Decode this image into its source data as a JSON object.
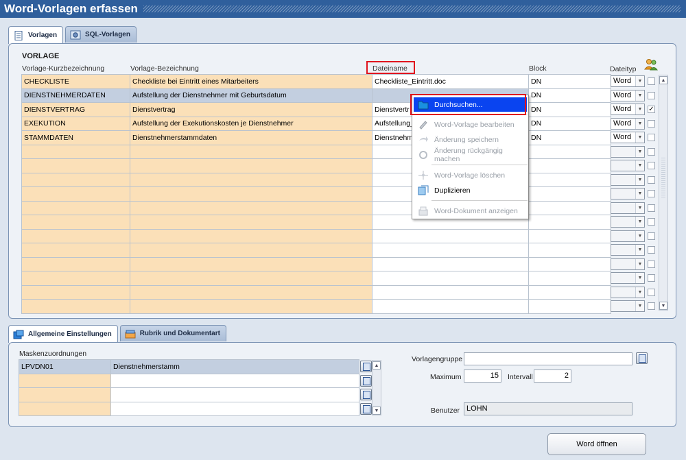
{
  "window": {
    "title": "Word-Vorlagen erfassen"
  },
  "top_tabs": [
    {
      "label": "Vorlagen",
      "icon": "document-lines-icon"
    },
    {
      "label": "SQL-Vorlagen",
      "icon": "sql-gear-icon"
    }
  ],
  "vorlage": {
    "section_label": "VORLAGE",
    "columns": {
      "kurz": "Vorlage-Kurzbezeichnung",
      "bez": "Vorlage-Bezeichnung",
      "datei": "Dateiname",
      "block": "Block",
      "typ": "Dateityp"
    },
    "rows": [
      {
        "kurz": "CHECKLISTE",
        "bez": "Checkliste bei Eintritt eines Mitarbeiters",
        "datei": "Checkliste_Eintritt.doc",
        "block": "DN",
        "typ": "Word",
        "checked": false
      },
      {
        "kurz": "DIENSTNEHMERDATEN",
        "bez": "Aufstellung der Dienstnehmer mit Geburtsdatum",
        "datei": "",
        "block": "DN",
        "typ": "Word",
        "checked": false
      },
      {
        "kurz": "DIENSTVERTRAG",
        "bez": "Dienstvertrag",
        "datei": "Dienstvertr",
        "block": "DN",
        "typ": "Word",
        "checked": true
      },
      {
        "kurz": "EXEKUTION",
        "bez": "Aufstellung der Exekutionskosten je Dienstnehmer",
        "datei": "Aufstellung_",
        "block": "DN",
        "typ": "Word",
        "checked": false
      },
      {
        "kurz": "STAMMDATEN",
        "bez": "Dienstnehmerstammdaten",
        "datei": "Dienstnehm",
        "block": "DN",
        "typ": "Word",
        "checked": false
      }
    ],
    "empty_row_count": 12
  },
  "context_menu": {
    "items": [
      {
        "label": "Durchsuchen...",
        "icon": "folder-icon",
        "enabled": true,
        "highlighted": true
      },
      {
        "label": "Word-Vorlage bearbeiten",
        "icon": "pencil-icon",
        "enabled": false
      },
      {
        "label": "Änderung speichern",
        "icon": "arrow-right-icon",
        "enabled": false
      },
      {
        "label": "Änderung rückgängig machen",
        "icon": "undo-icon",
        "enabled": false
      },
      {
        "label": "Word-Vorlage löschen",
        "icon": "crosshair-delete-icon",
        "enabled": false
      },
      {
        "label": "Duplizieren",
        "icon": "duplicate-icon",
        "enabled": true
      },
      {
        "label": "Word-Dokument anzeigen",
        "icon": "document-view-icon",
        "enabled": false
      }
    ]
  },
  "bottom_tabs": [
    {
      "label": "Allgemeine Einstellungen",
      "icon": "settings-blue-icon"
    },
    {
      "label": "Rubrik und Dokumentart",
      "icon": "folder-stack-icon"
    }
  ],
  "masken": {
    "section_label": "Maskenzuordnungen",
    "rows": [
      {
        "code": "LPVDN01",
        "name": "Dienstnehmerstamm"
      },
      {
        "code": "",
        "name": ""
      },
      {
        "code": "",
        "name": ""
      },
      {
        "code": "",
        "name": ""
      }
    ]
  },
  "settings": {
    "vorlagengruppe_label": "Vorlagengruppe",
    "vorlagengruppe_value": "",
    "maximum_label": "Maximum",
    "maximum_value": "15",
    "intervall_label": "Intervall",
    "intervall_value": "2",
    "benutzer_label": "Benutzer",
    "benutzer_value": "LOHN"
  },
  "buttons": {
    "word_oeffnen": "Word öffnen"
  },
  "colors": {
    "title_bar": "#2f5f9c",
    "key_cell": "#fbe0b8",
    "menu_highlight": "#0a44f0",
    "annotation_red": "#e0141e"
  }
}
